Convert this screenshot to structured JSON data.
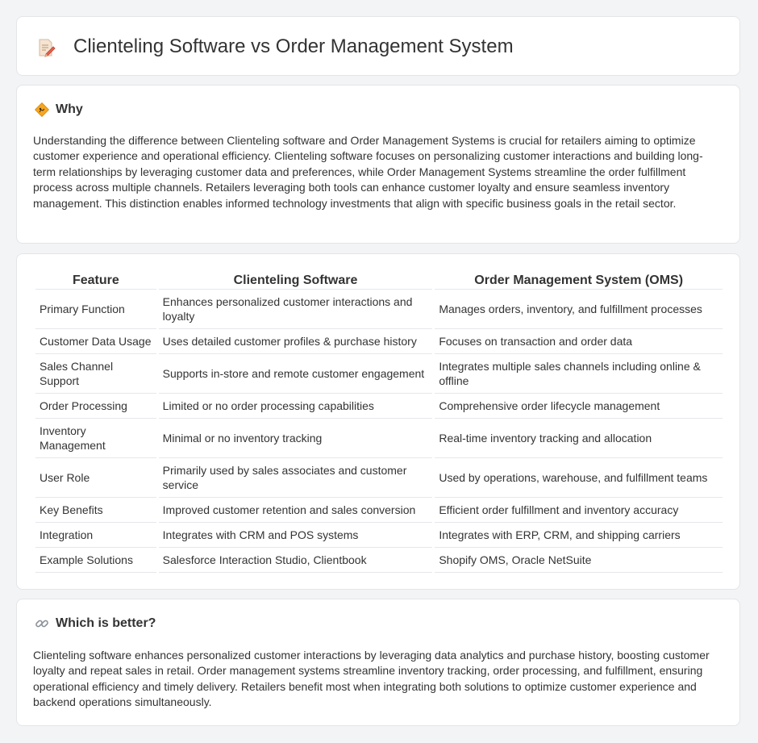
{
  "header": {
    "title": "Clienteling Software vs Order Management System",
    "icon": "document-pencil-icon"
  },
  "why": {
    "heading": "Why",
    "icon": "warning-sign-icon",
    "body": "Understanding the difference between Clienteling software and Order Management Systems is crucial for retailers aiming to optimize customer experience and operational efficiency. Clienteling software focuses on personalizing customer interactions and building long-term relationships by leveraging customer data and preferences, while Order Management Systems streamline the order fulfillment process across multiple channels. Retailers leveraging both tools can enhance customer loyalty and ensure seamless inventory management. This distinction enables informed technology investments that align with specific business goals in the retail sector."
  },
  "table": {
    "headers": [
      "Feature",
      "Clienteling Software",
      "Order Management System (OMS)"
    ],
    "rows": [
      [
        "Primary Function",
        "Enhances personalized customer interactions and loyalty",
        "Manages orders, inventory, and fulfillment processes"
      ],
      [
        "Customer Data Usage",
        "Uses detailed customer profiles & purchase history",
        "Focuses on transaction and order data"
      ],
      [
        "Sales Channel Support",
        "Supports in-store and remote customer engagement",
        "Integrates multiple sales channels including online & offline"
      ],
      [
        "Order Processing",
        "Limited or no order processing capabilities",
        "Comprehensive order lifecycle management"
      ],
      [
        "Inventory Management",
        "Minimal or no inventory tracking",
        "Real-time inventory tracking and allocation"
      ],
      [
        "User Role",
        "Primarily used by sales associates and customer service",
        "Used by operations, warehouse, and fulfillment teams"
      ],
      [
        "Key Benefits",
        "Improved customer retention and sales conversion",
        "Efficient order fulfillment and inventory accuracy"
      ],
      [
        "Integration",
        "Integrates with CRM and POS systems",
        "Integrates with ERP, CRM, and shipping carriers"
      ],
      [
        "Example Solutions",
        "Salesforce Interaction Studio, Clientbook",
        "Shopify OMS, Oracle NetSuite"
      ]
    ]
  },
  "better": {
    "heading": "Which is better?",
    "icon": "link-icon",
    "body": "Clienteling software enhances personalized customer interactions by leveraging data analytics and purchase history, boosting customer loyalty and repeat sales in retail. Order management systems streamline inventory tracking, order processing, and fulfillment, ensuring operational efficiency and timely delivery. Retailers benefit most when integrating both solutions to optimize customer experience and backend operations simultaneously."
  }
}
